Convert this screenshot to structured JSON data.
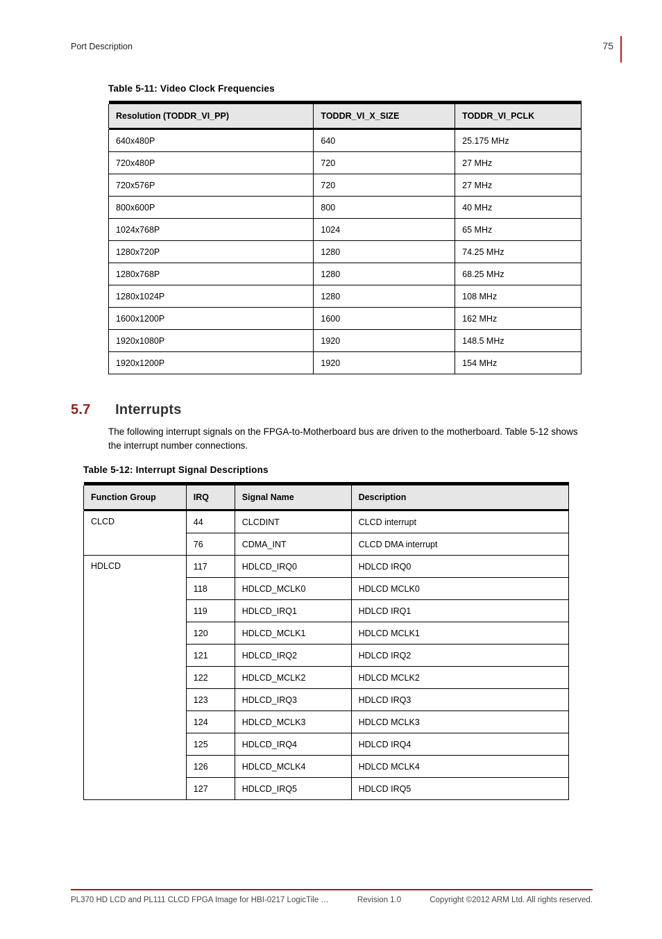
{
  "corner_page": "75",
  "running_head": "Port Description",
  "table5": {
    "caption": "Table 5-11: Video Clock Frequencies",
    "headers": [
      "Resolution (TODDR_VI_PP)",
      "TODDR_VI_X_SIZE",
      "TODDR_VI_PCLK"
    ],
    "rows": [
      [
        "640x480P",
        "640",
        "25.175 MHz"
      ],
      [
        "720x480P",
        "720",
        "27 MHz"
      ],
      [
        "720x576P",
        "720",
        "27 MHz"
      ],
      [
        "800x600P",
        "800",
        "40 MHz"
      ],
      [
        "1024x768P",
        "1024",
        "65 MHz"
      ],
      [
        "1280x720P",
        "1280",
        "74.25 MHz"
      ],
      [
        "1280x768P",
        "1280",
        "68.25 MHz"
      ],
      [
        "1280x1024P",
        "1280",
        "108 MHz"
      ],
      [
        "1600x1200P",
        "1600",
        "162 MHz"
      ],
      [
        "1920x1080P",
        "1920",
        "148.5 MHz"
      ],
      [
        "1920x1200P",
        "1920",
        "154 MHz"
      ]
    ]
  },
  "section": {
    "number": "5.7",
    "title": "Interrupts",
    "body": "The following interrupt signals on the FPGA-to-Motherboard bus are driven to the motherboard. Table 5-12 shows the interrupt number connections."
  },
  "table6": {
    "caption": "Table 5-12: Interrupt Signal Descriptions",
    "headers": [
      "Function Group",
      "IRQ",
      "Signal Name",
      "Description"
    ],
    "groups": [
      {
        "group": "CLCD",
        "rows": [
          [
            "44",
            "CLCDINT",
            "CLCD interrupt"
          ],
          [
            "76",
            "CDMA_INT",
            "CLCD DMA interrupt"
          ]
        ]
      },
      {
        "group": "HDLCD",
        "rows": [
          [
            "117",
            "HDLCD_IRQ0",
            "HDLCD IRQ0"
          ],
          [
            "118",
            "HDLCD_MCLK0",
            "HDLCD MCLK0"
          ],
          [
            "119",
            "HDLCD_IRQ1",
            "HDLCD IRQ1"
          ],
          [
            "120",
            "HDLCD_MCLK1",
            "HDLCD MCLK1"
          ],
          [
            "121",
            "HDLCD_IRQ2",
            "HDLCD IRQ2"
          ],
          [
            "122",
            "HDLCD_MCLK2",
            "HDLCD MCLK2"
          ],
          [
            "123",
            "HDLCD_IRQ3",
            "HDLCD IRQ3"
          ],
          [
            "124",
            "HDLCD_MCLK3",
            "HDLCD MCLK3"
          ],
          [
            "125",
            "HDLCD_IRQ4",
            "HDLCD IRQ4"
          ],
          [
            "126",
            "HDLCD_MCLK4",
            "HDLCD MCLK4"
          ],
          [
            "127",
            "HDLCD_IRQ5",
            "HDLCD IRQ5"
          ]
        ]
      }
    ]
  },
  "footer": {
    "left": "PL370 HD LCD and PL111 CLCD FPGA Image for HBI-0217 LogicTile …",
    "center": "Revision 1.0",
    "right": "Copyright ©2012 ARM Ltd. All rights reserved."
  }
}
